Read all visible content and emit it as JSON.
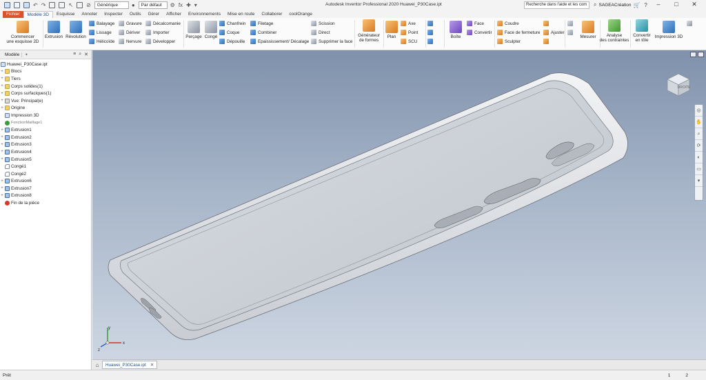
{
  "quick_access": {
    "appearance_value": "Générique",
    "material_value": "Par défaut",
    "fx_label": "fx"
  },
  "window": {
    "title": "Autodesk Inventor Professional 2020   Huawei_P30Case.ipt",
    "search_placeholder": "Recherche dans l'aide et les com",
    "user": "SAGEACréation",
    "help_label": "?"
  },
  "tabs": [
    {
      "label": "Fichier"
    },
    {
      "label": "Modèle 3D"
    },
    {
      "label": "Esquisse"
    },
    {
      "label": "Annoter"
    },
    {
      "label": "Inspecter"
    },
    {
      "label": "Outils"
    },
    {
      "label": "Gérer"
    },
    {
      "label": "Afficher"
    },
    {
      "label": "Environnements"
    },
    {
      "label": "Mise en route"
    },
    {
      "label": "Collaborer"
    },
    {
      "label": "coolOrange"
    }
  ],
  "ribbon": {
    "sketch": {
      "line1": "Commencer",
      "line2": "une esquisse 2D"
    },
    "extrusion": "Extrusion",
    "revolution": "Révolution",
    "balayage": "Balayage",
    "lissage": "Lissage",
    "helicoide": "Hélicoïde",
    "gravure": "Gravure",
    "deriver": "Dériver",
    "nervure": "Nervure",
    "decalcomanie": "Décalcomanie",
    "importer": "Importer",
    "developper": "Développer",
    "percage": "Perçage",
    "conge": "Congé",
    "chanfrein": "Chanfrein",
    "coque": "Coque",
    "depouille": "Dépouille",
    "filetage": "Filetage",
    "combiner": "Combiner",
    "epaississement": "Epaississement/ Décalage",
    "scission": "Scission",
    "direct": "Direct",
    "supprimer_face": "Supprimer la face",
    "generateur": {
      "line1": "Générateur",
      "line2": "de formes"
    },
    "plan": "Plan",
    "axe": "Axe",
    "point": "Point",
    "scu": "SCU",
    "boite": "Boîte",
    "face": "Face",
    "convertir": "Convertir",
    "coudre": "Coudre",
    "face_fermeture": "Face de fermeture",
    "sculpter": "Sculpter",
    "ajuster": "Ajuster",
    "mesurer": "Mesurer",
    "analyse": {
      "line1": "Analyse",
      "line2": "des contraintes"
    },
    "convertir_tole": {
      "line1": "Convertir",
      "line2": "en tôle"
    },
    "impression3d": "Impression 3D"
  },
  "browser": {
    "tab_label": "Modèle",
    "root": "Huawei_P30Case.ipt",
    "nodes": [
      {
        "label": "Blocs",
        "icon": "folder"
      },
      {
        "label": "Tiers",
        "icon": "folder"
      },
      {
        "label": "Corps solides(1)",
        "icon": "folder"
      },
      {
        "label": "Corps surfaciques(1)",
        "icon": "folder"
      },
      {
        "label": "Vue: Principal(e)",
        "icon": "view"
      },
      {
        "label": "Origine",
        "icon": "folder"
      },
      {
        "label": "Impression 3D",
        "icon": "part"
      },
      {
        "label": "FonctionMaillage1",
        "icon": "check"
      },
      {
        "label": "Extrusion1",
        "icon": "feat"
      },
      {
        "label": "Extrusion2",
        "icon": "feat"
      },
      {
        "label": "Extrusion3",
        "icon": "feat"
      },
      {
        "label": "Extrusion4",
        "icon": "feat"
      },
      {
        "label": "Extrusion5",
        "icon": "feat"
      },
      {
        "label": "Congé1",
        "icon": "fillet"
      },
      {
        "label": "Congé2",
        "icon": "fillet"
      },
      {
        "label": "Extrusion6",
        "icon": "feat"
      },
      {
        "label": "Extrusion7",
        "icon": "feat"
      },
      {
        "label": "Extrusion8",
        "icon": "feat"
      },
      {
        "label": "Fin de la pièce",
        "icon": "end"
      }
    ]
  },
  "viewcube": {
    "face_label": "DROITE"
  },
  "triad": {
    "x": "x",
    "y": "y",
    "z": "z"
  },
  "doc_tab": "Huawei_P30Case.ipt",
  "status": {
    "left": "Prêt",
    "count1": "1",
    "count2": "2"
  },
  "colors": {
    "file_tab": "#d8532b",
    "accent": "#1f4e8c"
  }
}
